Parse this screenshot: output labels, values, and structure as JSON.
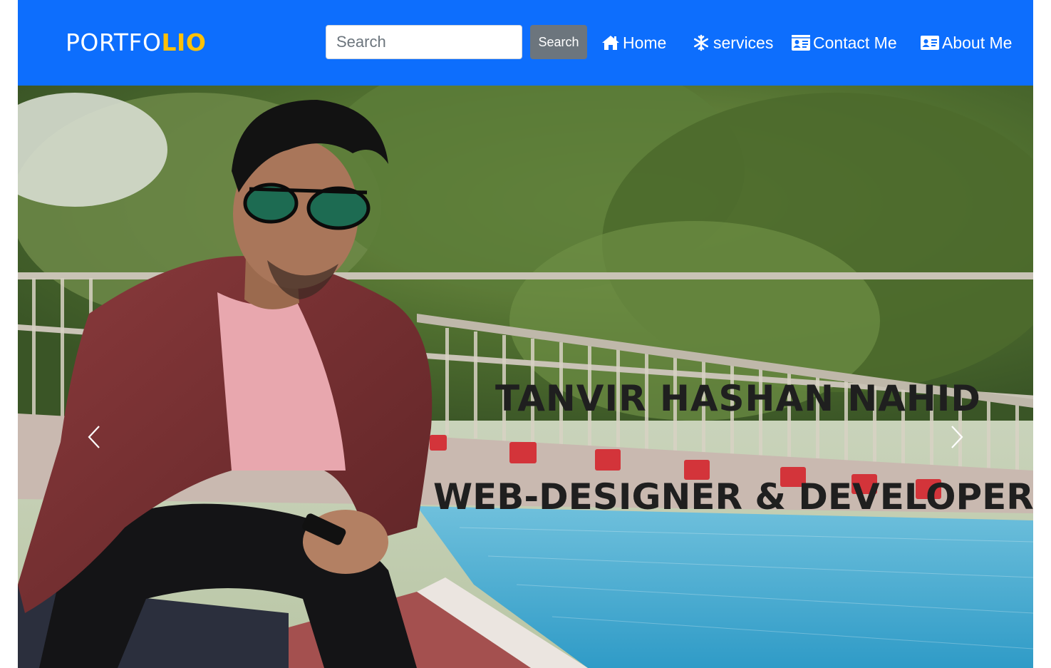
{
  "navbar": {
    "brand_part1": "PORTFO",
    "brand_part2": "LIO",
    "search_placeholder": "Search",
    "search_button": "Search",
    "links": [
      {
        "label": "Home",
        "icon": "home-icon"
      },
      {
        "label": "services",
        "icon": "snowflake-icon"
      },
      {
        "label": "Contact Me",
        "icon": "contact-card-icon"
      },
      {
        "label": "About Me",
        "icon": "id-card-icon"
      }
    ]
  },
  "hero": {
    "name": "TANVIR HASHAN NAHID",
    "role": "WEB-DESIGNER & DEVELOPER",
    "controls": {
      "prev_icon": "chevron-left-icon",
      "next_icon": "chevron-right-icon"
    }
  },
  "colors": {
    "navbar_bg": "#0d6efd",
    "brand_accent": "#ffc107",
    "search_button_bg": "#6c757d",
    "caption_text": "#1f1f1f"
  }
}
